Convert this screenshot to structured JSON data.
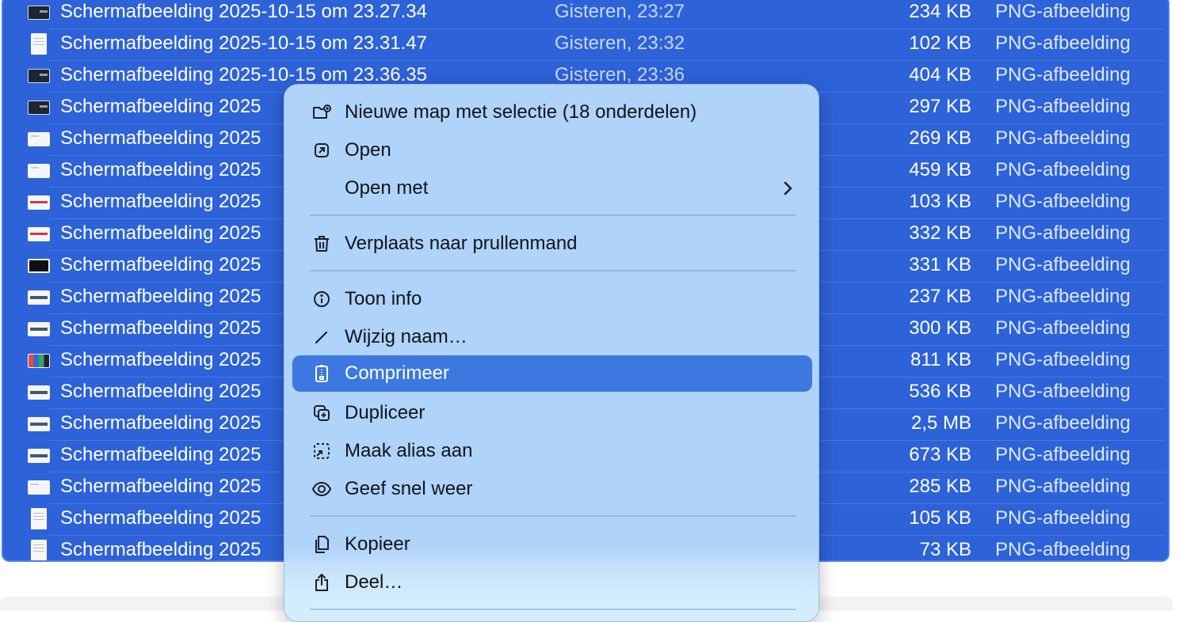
{
  "files": [
    {
      "name": "Schermafbeelding 2025-10-15 om 23.27.34",
      "date": "Gisteren, 23:27",
      "size": "234 KB",
      "kind": "PNG-afbeelding",
      "thumb": "dark"
    },
    {
      "name": "Schermafbeelding 2025-10-15 om 23.31.47",
      "date": "Gisteren, 23:32",
      "size": "102 KB",
      "kind": "PNG-afbeelding",
      "thumb": "doc"
    },
    {
      "name": "Schermafbeelding 2025-10-15 om 23.36.35",
      "date": "Gisteren, 23:36",
      "size": "404 KB",
      "kind": "PNG-afbeelding",
      "thumb": "dark"
    },
    {
      "name": "Schermafbeelding 2025",
      "date": "",
      "size": "297 KB",
      "kind": "PNG-afbeelding",
      "thumb": "dark"
    },
    {
      "name": "Schermafbeelding 2025",
      "date": "",
      "size": "269 KB",
      "kind": "PNG-afbeelding",
      "thumb": "light"
    },
    {
      "name": "Schermafbeelding 2025",
      "date": "",
      "size": "459 KB",
      "kind": "PNG-afbeelding",
      "thumb": "light"
    },
    {
      "name": "Schermafbeelding 2025",
      "date": "",
      "size": "103 KB",
      "kind": "PNG-afbeelding",
      "thumb": "red"
    },
    {
      "name": "Schermafbeelding 2025",
      "date": "",
      "size": "332 KB",
      "kind": "PNG-afbeelding",
      "thumb": "red"
    },
    {
      "name": "Schermafbeelding 2025",
      "date": "",
      "size": "331 KB",
      "kind": "PNG-afbeelding",
      "thumb": "black"
    },
    {
      "name": "Schermafbeelding 2025",
      "date": "",
      "size": "237 KB",
      "kind": "PNG-afbeelding",
      "thumb": "strip"
    },
    {
      "name": "Schermafbeelding 2025",
      "date": "",
      "size": "300 KB",
      "kind": "PNG-afbeelding",
      "thumb": "strip"
    },
    {
      "name": "Schermafbeelding 2025",
      "date": "",
      "size": "811 KB",
      "kind": "PNG-afbeelding",
      "thumb": "multi"
    },
    {
      "name": "Schermafbeelding 2025",
      "date": "",
      "size": "536 KB",
      "kind": "PNG-afbeelding",
      "thumb": "strip"
    },
    {
      "name": "Schermafbeelding 2025",
      "date": "",
      "size": "2,5 MB",
      "kind": "PNG-afbeelding",
      "thumb": "strip"
    },
    {
      "name": "Schermafbeelding 2025",
      "date": "",
      "size": "673 KB",
      "kind": "PNG-afbeelding",
      "thumb": "strip"
    },
    {
      "name": "Schermafbeelding 2025",
      "date": "",
      "size": "285 KB",
      "kind": "PNG-afbeelding",
      "thumb": "light"
    },
    {
      "name": "Schermafbeelding 2025",
      "date": "",
      "size": "105 KB",
      "kind": "PNG-afbeelding",
      "thumb": "doc"
    },
    {
      "name": "Schermafbeelding 2025",
      "date": "",
      "size": "73 KB",
      "kind": "PNG-afbeelding",
      "thumb": "doc"
    }
  ],
  "menu": {
    "items": [
      {
        "label": "Nieuwe map met selectie (18 onderdelen)",
        "icon": "new-folder-icon"
      },
      {
        "label": "Open",
        "icon": "open-icon"
      },
      {
        "label": "Open met",
        "icon": "",
        "submenu": true
      },
      {
        "label": "Verplaats naar prullenmand",
        "icon": "trash-icon"
      },
      {
        "label": "Toon info",
        "icon": "info-icon"
      },
      {
        "label": "Wijzig naam…",
        "icon": "pencil-icon"
      },
      {
        "label": "Comprimeer",
        "icon": "archive-icon",
        "highlighted": true
      },
      {
        "label": "Dupliceer",
        "icon": "duplicate-icon"
      },
      {
        "label": "Maak alias aan",
        "icon": "alias-icon"
      },
      {
        "label": "Geef snel weer",
        "icon": "eye-icon"
      },
      {
        "label": "Kopieer",
        "icon": "copy-icon"
      },
      {
        "label": "Deel…",
        "icon": "share-icon"
      }
    ]
  },
  "colors": {
    "selection": "#2d62d8",
    "menu_bg": "#b5d7fa",
    "highlight": "#3c78df"
  }
}
